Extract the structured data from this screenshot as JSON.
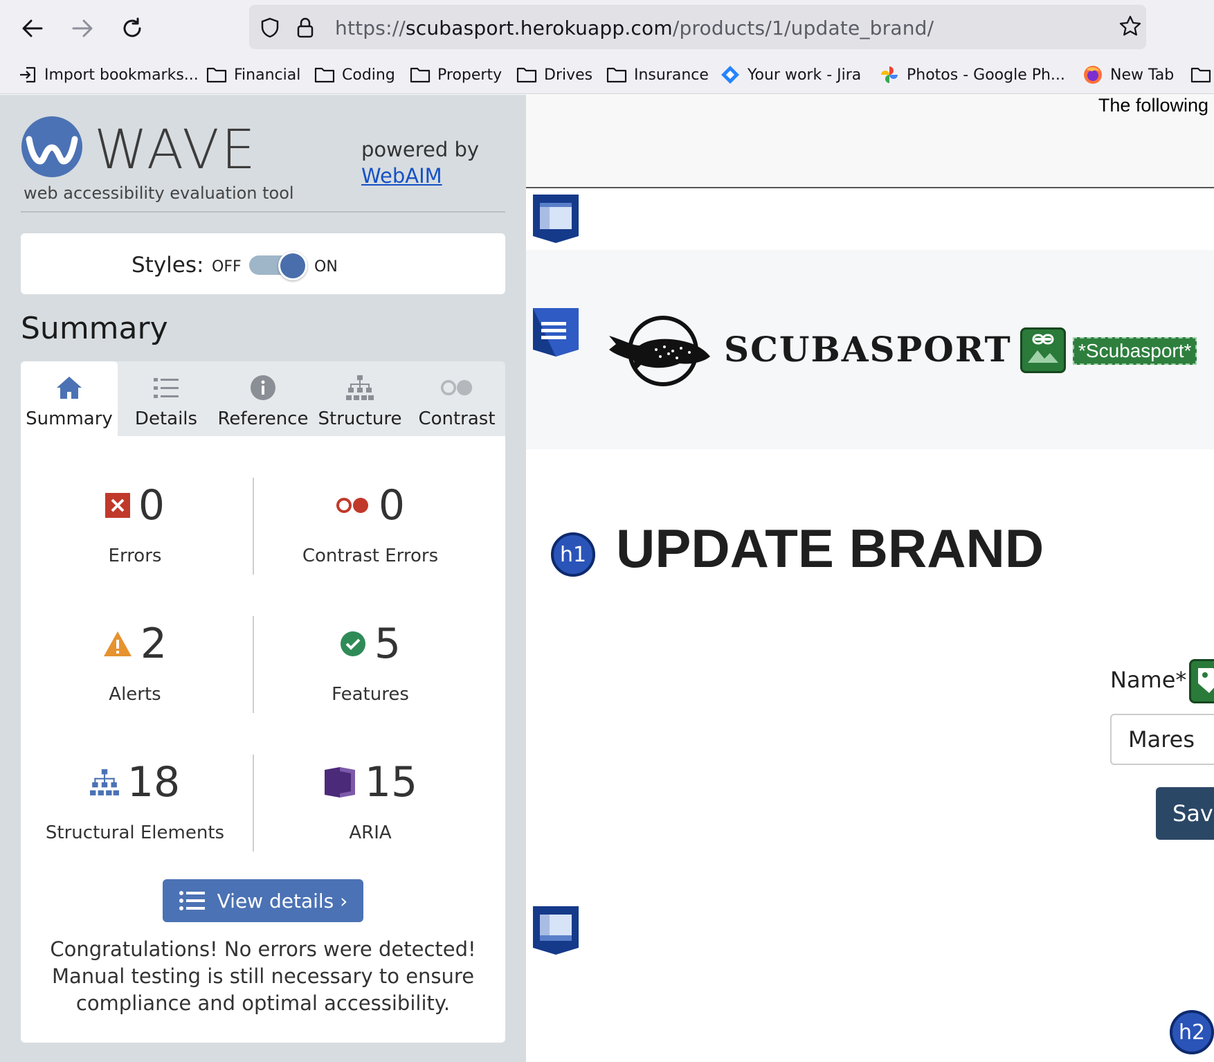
{
  "browser": {
    "url_prefix": "https://",
    "url_host": "scubasport.herokuapp.com",
    "url_path": "/products/1/update_brand/",
    "bookmarks": [
      {
        "label": "Import bookmarks...",
        "icon": "import-icon"
      },
      {
        "label": "Financial",
        "icon": "folder-icon"
      },
      {
        "label": "Coding",
        "icon": "folder-icon"
      },
      {
        "label": "Property",
        "icon": "folder-icon"
      },
      {
        "label": "Drives",
        "icon": "folder-icon"
      },
      {
        "label": "Insurance",
        "icon": "folder-icon"
      },
      {
        "label": "Your work - Jira",
        "icon": "jira-icon"
      },
      {
        "label": "Photos - Google Ph...",
        "icon": "google-photos-icon"
      },
      {
        "label": "New Tab",
        "icon": "firefox-icon"
      }
    ]
  },
  "wave": {
    "title": "WAVE",
    "subtitle": "web accessibility evaluation tool",
    "powered_by": "powered by",
    "webaim_link": "WebAIM",
    "styles_label": "Styles:",
    "styles_off": "OFF",
    "styles_on": "ON",
    "styles_enabled": true,
    "summary_heading": "Summary",
    "tabs": [
      {
        "label": "Summary",
        "icon": "home-icon",
        "active": true
      },
      {
        "label": "Details",
        "icon": "list-icon",
        "active": false
      },
      {
        "label": "Reference",
        "icon": "info-icon",
        "active": false
      },
      {
        "label": "Structure",
        "icon": "structure-icon",
        "active": false
      },
      {
        "label": "Contrast",
        "icon": "contrast-icon",
        "active": false
      }
    ],
    "stats": {
      "errors": {
        "value": "0",
        "label": "Errors"
      },
      "contrast_errors": {
        "value": "0",
        "label": "Contrast Errors"
      },
      "alerts": {
        "value": "2",
        "label": "Alerts"
      },
      "features": {
        "value": "5",
        "label": "Features"
      },
      "structural": {
        "value": "18",
        "label": "Structural Elements"
      },
      "aria": {
        "value": "15",
        "label": "ARIA"
      }
    },
    "view_details": "View details ›",
    "congrats": "Congratulations! No errors were detected! Manual testing is still necessary to ensure compliance and optimal accessibility."
  },
  "site": {
    "top_notice": "The following",
    "brand": "SCUBASPORT",
    "logo_alt": "*Scubasport*",
    "h1_badge": "h1",
    "heading": "UPDATE BRAND",
    "name_label": "Name*",
    "name_value": "Mares",
    "save_label": "Save",
    "h2_badge": "h2"
  },
  "colors": {
    "wave_blue": "#4b72b4",
    "error_red": "#c0392b",
    "alert_orange": "#e6922f",
    "feature_green": "#2e8b57",
    "aria_purple": "#4b2a7a",
    "save_button": "#2b4766"
  }
}
